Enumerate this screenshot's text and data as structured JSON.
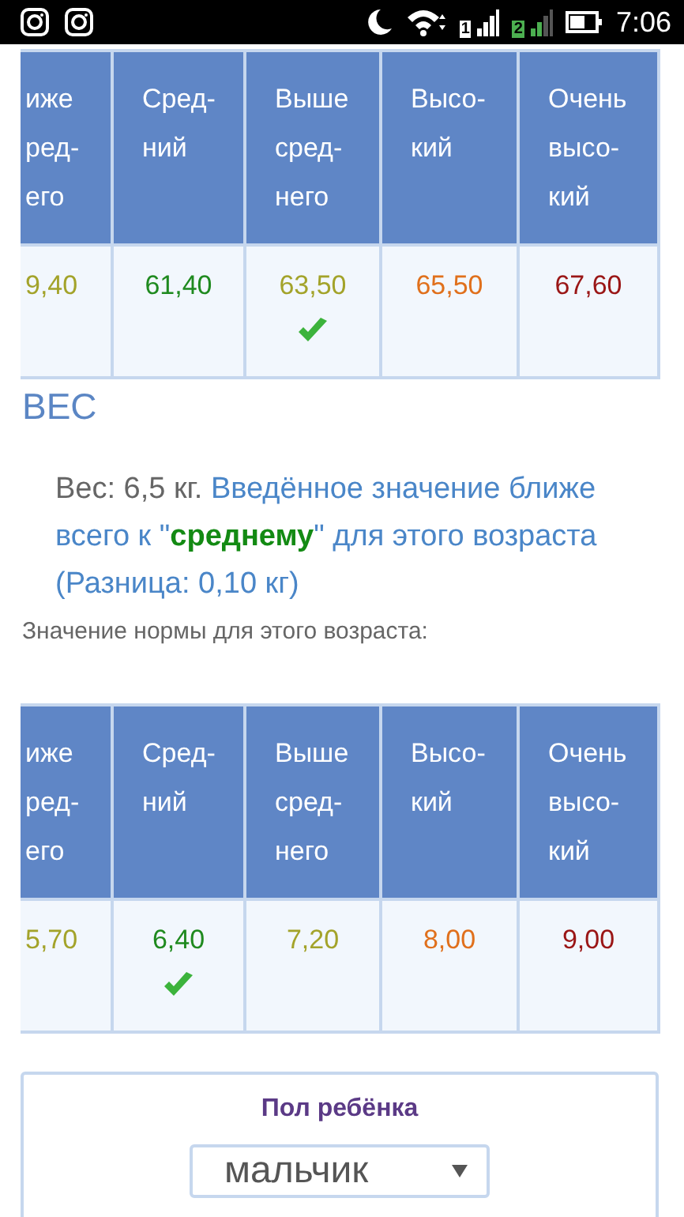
{
  "status_bar": {
    "time": "7:06",
    "sim_labels": [
      "1",
      "2"
    ]
  },
  "upper_table": {
    "columns": [
      {
        "lines": [
          "иже",
          "ред-",
          "его"
        ]
      },
      {
        "lines": [
          "Сред-",
          "ний"
        ]
      },
      {
        "lines": [
          "Выше",
          "сред-",
          "него"
        ]
      },
      {
        "lines": [
          "Высо-",
          "кий"
        ]
      },
      {
        "lines": [
          "Очень",
          "высо-",
          "кий"
        ]
      }
    ],
    "cells": [
      {
        "value": "9,40",
        "color": "#a3a32a",
        "checked": false
      },
      {
        "value": "61,40",
        "color": "#1f8a1f",
        "checked": false
      },
      {
        "value": "63,50",
        "color": "#a3a32a",
        "checked": true
      },
      {
        "value": "65,50",
        "color": "#e0701c",
        "checked": false
      },
      {
        "value": "67,60",
        "color": "#9a1616",
        "checked": false
      }
    ]
  },
  "weight": {
    "title": "ВЕС",
    "reading": "Вес: 6,5 кг.",
    "result": "Введённое значение ближе всего к \"**среднему**\" для этого возраста (Разница: 0,10 кг)",
    "norm_caption": "Значение нормы для этого возраста:",
    "table": {
      "columns": [
        {
          "lines": [
            "иже",
            "ред-",
            "его"
          ]
        },
        {
          "lines": [
            "Сред-",
            "ний"
          ]
        },
        {
          "lines": [
            "Выше",
            "сред-",
            "него"
          ]
        },
        {
          "lines": [
            "Высо-",
            "кий"
          ]
        },
        {
          "lines": [
            "Очень",
            "высо-",
            "кий"
          ]
        }
      ],
      "cells": [
        {
          "value": "5,70",
          "color": "#a3a32a",
          "checked": false
        },
        {
          "value": "6,40",
          "color": "#1f8a1f",
          "checked": true
        },
        {
          "value": "7,20",
          "color": "#a3a32a",
          "checked": false
        },
        {
          "value": "8,00",
          "color": "#e0701c",
          "checked": false
        },
        {
          "value": "9,00",
          "color": "#9a1616",
          "checked": false
        }
      ]
    }
  },
  "gender_card": {
    "title": "Пол ребёнка",
    "select_value": "мальчик"
  }
}
